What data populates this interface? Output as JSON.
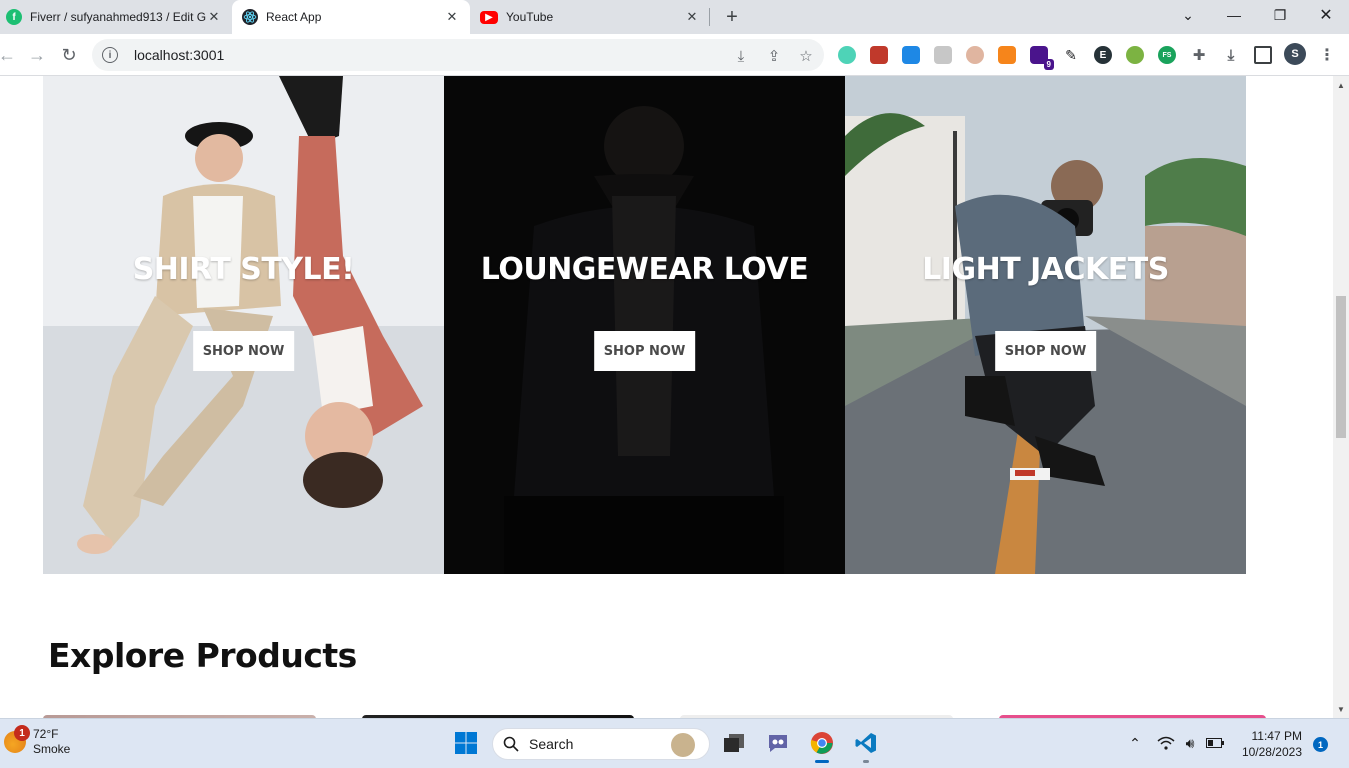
{
  "browser": {
    "tabs": [
      {
        "title": "Fiverr / sufyanahmed913 / Edit G",
        "favicon": "fiverr-icon",
        "active": false
      },
      {
        "title": "React App",
        "favicon": "react-icon",
        "active": true
      },
      {
        "title": "YouTube",
        "favicon": "youtube-icon",
        "active": false
      }
    ],
    "new_tab": "+",
    "url": "localhost:3001",
    "extensions_badge": "9",
    "profile_initial": "S"
  },
  "categories": [
    {
      "title": "SHIRT STYLE!",
      "button": "SHOP NOW"
    },
    {
      "title": "LOUNGEWEAR LOVE",
      "button": "SHOP NOW"
    },
    {
      "title": "LIGHT JACKETS",
      "button": "SHOP NOW"
    }
  ],
  "explore": {
    "title": "Explore Products"
  },
  "taskbar": {
    "weather": {
      "temp": "72°F",
      "condition": "Smoke",
      "badge": "1"
    },
    "search_label": "Search",
    "time": "11:47 PM",
    "date": "10/28/2023",
    "notifications": "1"
  },
  "colors": {
    "tabbar": "#dee1e6",
    "taskbar": "#dde6f3",
    "accent": "#0067c0"
  }
}
